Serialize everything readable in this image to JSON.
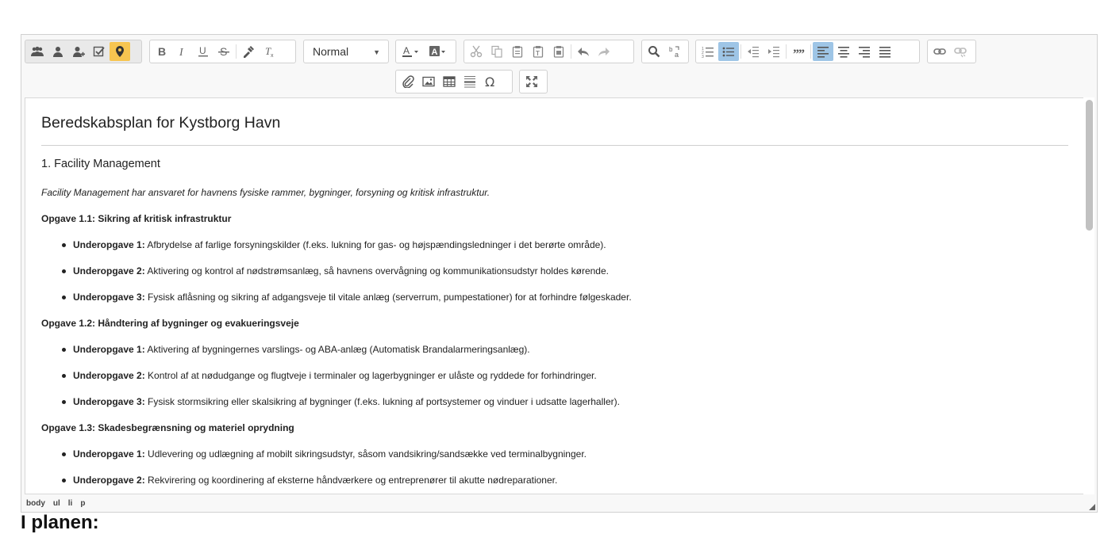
{
  "toolbar": {
    "format_select": {
      "value": "Normal"
    },
    "groups": {
      "plugins": [
        "users-group-icon",
        "user-icon",
        "user-add-icon",
        "checkbox-icon",
        "map-pin-icon"
      ],
      "basic_styles": [
        "bold-icon",
        "italic-icon",
        "underline-icon",
        "strikethrough-icon",
        "eyedropper-icon",
        "clear-format-icon"
      ],
      "colors": [
        "text-color-icon",
        "background-color-icon"
      ],
      "clipboard": [
        "cut-icon",
        "copy-icon",
        "paste-icon",
        "paste-text-icon",
        "paste-word-icon",
        "undo-icon",
        "redo-icon"
      ],
      "find": [
        "find-icon",
        "replace-icon"
      ],
      "paragraph": [
        "numbered-list-icon",
        "bulleted-list-icon",
        "outdent-icon",
        "indent-icon",
        "blockquote-icon",
        "align-left-icon",
        "align-center-icon",
        "align-right-icon",
        "justify-icon"
      ],
      "links": [
        "link-icon",
        "unlink-icon"
      ],
      "insert": [
        "attachment-icon",
        "image-icon",
        "table-icon",
        "horizontal-rule-icon",
        "special-char-icon"
      ],
      "tools": [
        "maximize-icon"
      ]
    },
    "colors": {
      "active": "#9ec5e6",
      "highlight": "#f7c550"
    }
  },
  "document": {
    "title": "Beredskabsplan for Kystborg Havn",
    "section": "1. Facility Management",
    "intro": "Facility Management har ansvaret for havnens fysiske rammer, bygninger, forsyning og kritisk infrastruktur.",
    "tasks": [
      {
        "title": "Opgave 1.1: Sikring af kritisk infrastruktur",
        "subtasks": [
          {
            "label": "Underopgave 1:",
            "text": "Afbrydelse af farlige forsyningskilder (f.eks. lukning for gas- og højspændingsledninger i det berørte område)."
          },
          {
            "label": "Underopgave 2:",
            "text": "Aktivering og kontrol af nødstrømsanlæg, så havnens overvågning og kommunikationsudstyr holdes kørende."
          },
          {
            "label": "Underopgave 3:",
            "text": "Fysisk aflåsning og sikring af adgangsveje til vitale anlæg (serverrum, pumpestationer) for at forhindre følgeskader."
          }
        ]
      },
      {
        "title": "Opgave 1.2: Håndtering af bygninger og evakueringsveje",
        "subtasks": [
          {
            "label": "Underopgave 1:",
            "text": "Aktivering af bygningernes varslings- og ABA-anlæg (Automatisk Brandalarmeringsanlæg)."
          },
          {
            "label": "Underopgave 2:",
            "text": "Kontrol af at nødudgange og flugtveje i terminaler og lagerbygninger er ulåste og ryddede for forhindringer."
          },
          {
            "label": "Underopgave 3:",
            "text": "Fysisk stormsikring eller skalsikring af bygninger (f.eks. lukning af portsystemer og vinduer i udsatte lagerhaller)."
          }
        ]
      },
      {
        "title": "Opgave 1.3: Skadesbegrænsning og materiel oprydning",
        "subtasks": [
          {
            "label": "Underopgave 1:",
            "text": "Udlevering og udlægning af mobilt sikringsudstyr, såsom vandsikring/sandsække ved terminalbygninger."
          },
          {
            "label": "Underopgave 2:",
            "text": "Rekvirering og koordinering af eksterne håndværkere og entreprenører til akutte nødreparationer."
          }
        ]
      }
    ]
  },
  "statusbar": {
    "path": [
      "body",
      "ul",
      "li",
      "p"
    ]
  },
  "below_heading": "I planen:"
}
